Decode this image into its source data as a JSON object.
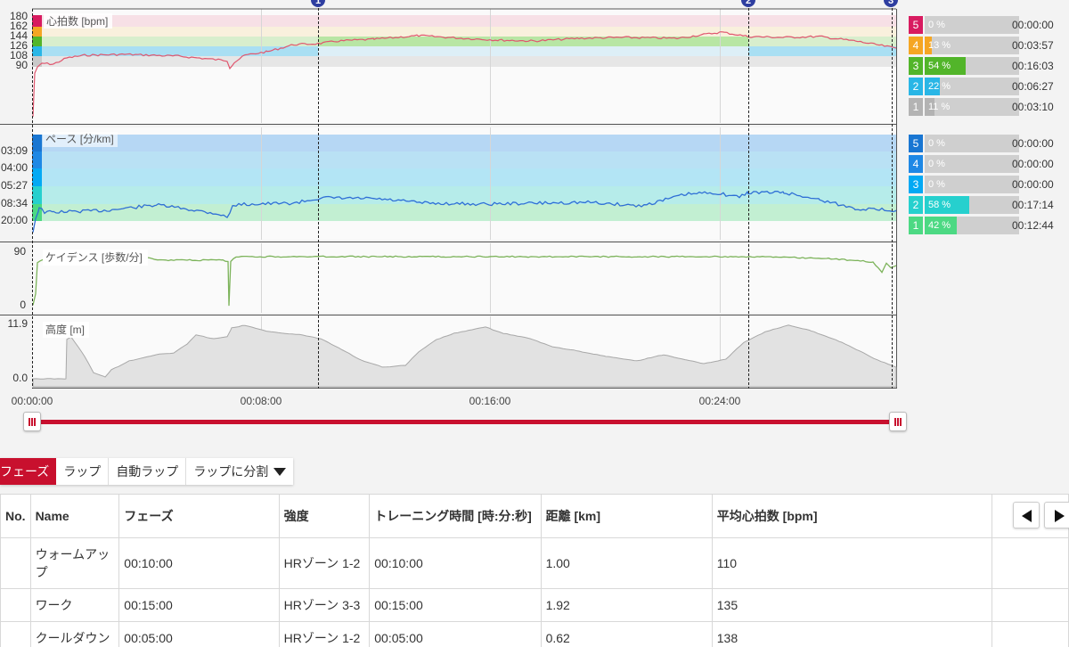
{
  "hr_panel": {
    "title": "心拍数 [bpm]",
    "y_ticks": [
      "180",
      "162",
      "144",
      "126",
      "108",
      "90"
    ]
  },
  "pace_panel": {
    "title": "ペース [分/km]",
    "y_ticks": [
      "03:09",
      "04:00",
      "05:27",
      "08:34",
      "20:00"
    ]
  },
  "cadence_panel": {
    "title": "ケイデンス [歩数/分]",
    "y_ticks": [
      "90",
      "0"
    ]
  },
  "altitude_panel": {
    "title": "高度 [m]",
    "y_ticks": [
      "11.9",
      "0.0"
    ]
  },
  "time_axis": [
    "00:00:00",
    "00:08:00",
    "00:16:00",
    "00:24:00"
  ],
  "lap_markers": [
    "1",
    "2",
    "3"
  ],
  "hr_zones": [
    {
      "num": "5",
      "pct": "0 %",
      "fill": 0.0,
      "time": "00:00:00",
      "color": "#d81b60",
      "bar": "#d81b60"
    },
    {
      "num": "4",
      "pct": "13 %",
      "fill": 0.13,
      "time": "00:03:57",
      "color": "#f5a623",
      "bar": "#f5a623"
    },
    {
      "num": "3",
      "pct": "54 %",
      "fill": 0.54,
      "time": "00:16:03",
      "color": "#52b52a",
      "bar": "#52b52a"
    },
    {
      "num": "2",
      "pct": "22 %",
      "fill": 0.22,
      "time": "00:06:27",
      "color": "#29b6e6",
      "bar": "#29b6e6"
    },
    {
      "num": "1",
      "pct": "11 %",
      "fill": 0.11,
      "time": "00:03:10",
      "color": "#b3b3b3",
      "bar": "#b3b3b3"
    }
  ],
  "pace_zones": [
    {
      "num": "5",
      "pct": "0 %",
      "fill": 0.0,
      "time": "00:00:00",
      "color": "#1976d2",
      "bar": "#1976d2"
    },
    {
      "num": "4",
      "pct": "0 %",
      "fill": 0.0,
      "time": "00:00:00",
      "color": "#1e88e5",
      "bar": "#1e88e5"
    },
    {
      "num": "3",
      "pct": "0 %",
      "fill": 0.0,
      "time": "00:00:00",
      "color": "#03a9f4",
      "bar": "#03a9f4"
    },
    {
      "num": "2",
      "pct": "58 %",
      "fill": 0.58,
      "time": "00:17:14",
      "color": "#26d0ce",
      "bar": "#26d0ce"
    },
    {
      "num": "1",
      "pct": "42 %",
      "fill": 0.42,
      "time": "00:12:44",
      "color": "#4cd983",
      "bar": "#4cd983"
    }
  ],
  "tabs": [
    "フェーズ",
    "ラップ",
    "自動ラップ",
    "ラップに分割"
  ],
  "table": {
    "headers": [
      "No.",
      "Name",
      "フェーズ",
      "強度",
      "トレーニング時間 [時:分:秒]",
      "距離 [km]",
      "平均心拍数 [bpm]"
    ],
    "rows": [
      [
        "",
        "ウォームアップ",
        "00:10:00",
        "HRゾーン 1-2",
        "00:10:00",
        "1.00",
        "110"
      ],
      [
        "",
        "ワーク",
        "00:15:00",
        "HRゾーン 3-3",
        "00:15:00",
        "1.92",
        "135"
      ],
      [
        "",
        "クールダウン",
        "00:05:00",
        "HRゾーン 1-2",
        "00:05:00",
        "0.62",
        "138"
      ]
    ]
  },
  "colors": {
    "accent": "#c8102e",
    "hr_line": "#e0566e",
    "pace_line": "#2f6fd6",
    "cadence_line": "#7cb35a",
    "altitude_fill": "#e2e2e2"
  }
}
